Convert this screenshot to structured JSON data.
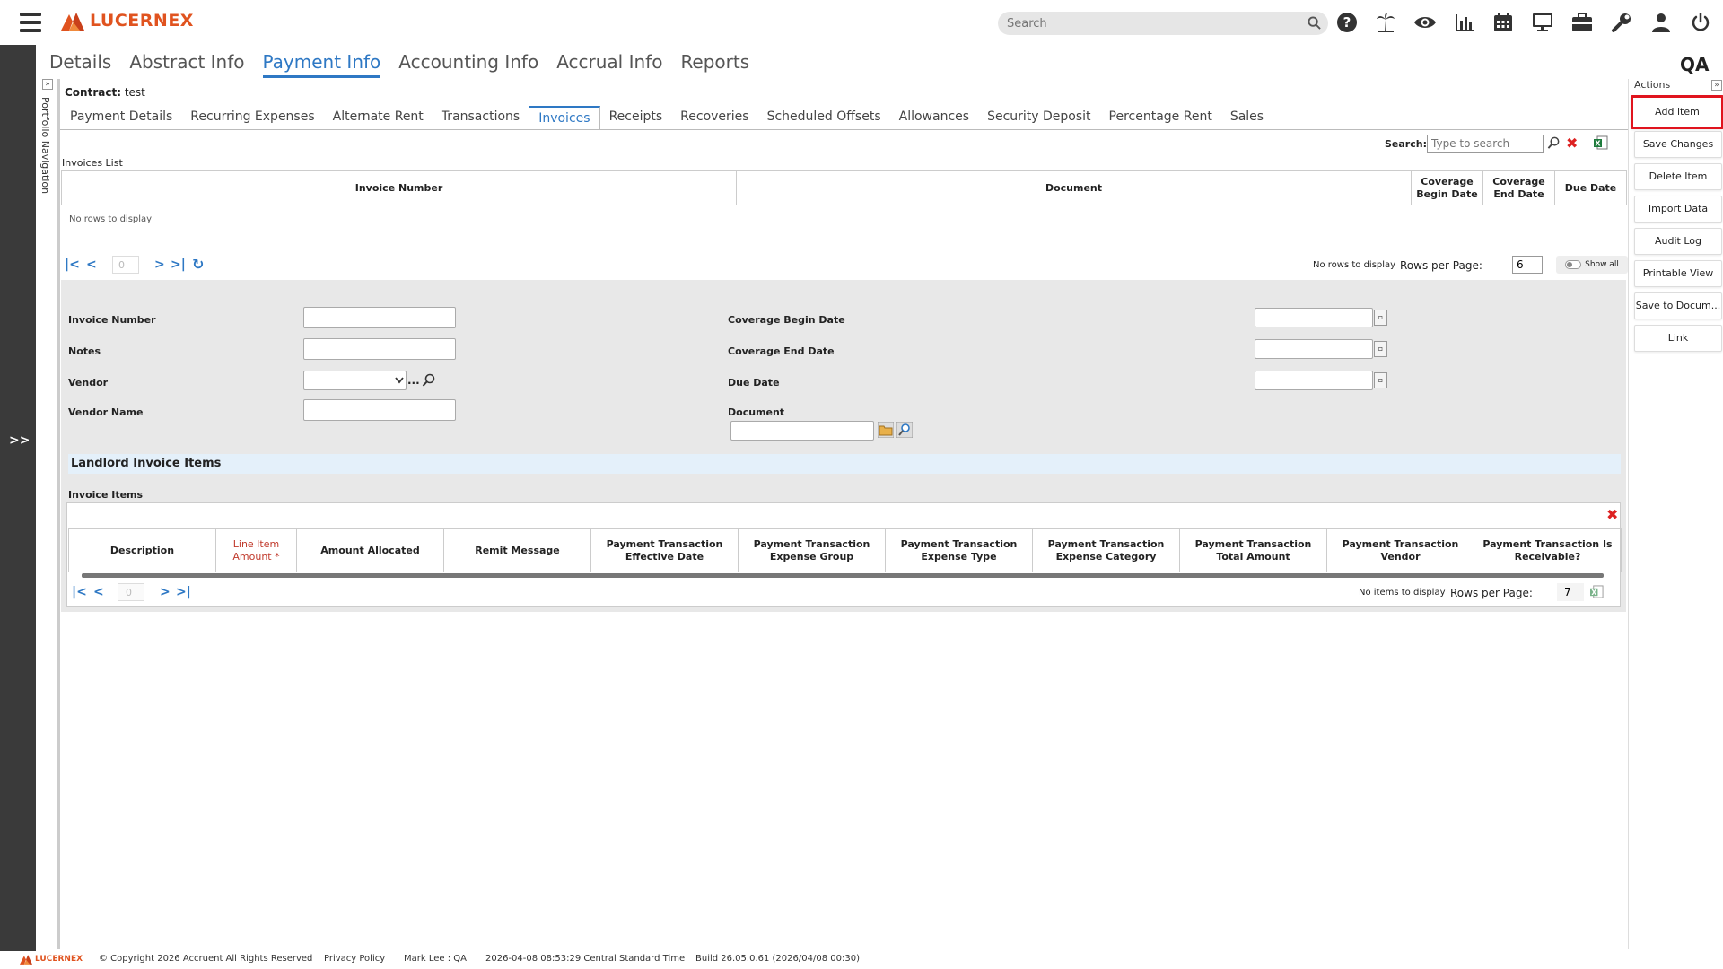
{
  "brand": {
    "name": "LUCERNEX"
  },
  "header": {
    "search_placeholder": "Search",
    "icons": [
      "help-icon",
      "palm-tree-icon",
      "eye-icon",
      "chart-icon",
      "calendar-icon",
      "monitor-icon",
      "briefcase-icon",
      "wrench-icon",
      "user-icon",
      "power-icon"
    ]
  },
  "main_tabs": [
    "Details",
    "Abstract Info",
    "Payment Info",
    "Accounting Info",
    "Accrual Info",
    "Reports"
  ],
  "main_tab_active": "Payment Info",
  "env_label": "QA",
  "left_nav": {
    "expand": ">>",
    "portfolio_label": "Portfolio Navigation",
    "toggle": "»"
  },
  "contract": {
    "label": "Contract:",
    "value": " test"
  },
  "sub_tabs": [
    "Payment Details",
    "Recurring Expenses",
    "Alternate Rent",
    "Transactions",
    "Invoices",
    "Receipts",
    "Recoveries",
    "Scheduled Offsets",
    "Allowances",
    "Security Deposit",
    "Percentage Rent",
    "Sales"
  ],
  "sub_tab_active": "Invoices",
  "invoices_list": {
    "search_label": "Search:",
    "search_placeholder": "Type to search",
    "title": "Invoices List",
    "columns": [
      "Invoice Number",
      "Document",
      "Coverage Begin Date",
      "Coverage End Date",
      "Due Date"
    ],
    "empty_text": "No rows to display",
    "page_value": "0",
    "no_rows": "No rows to display",
    "rows_per_page_label": "Rows per Page:",
    "rows_per_page": "6",
    "show_all": "Show all"
  },
  "form": {
    "invoice_number": "Invoice Number",
    "notes": "Notes",
    "vendor": "Vendor",
    "vendor_name": "Vendor Name",
    "coverage_begin": "Coverage Begin Date",
    "coverage_end": "Coverage End Date",
    "due_date": "Due Date",
    "document": "Document",
    "vendor_ellipsis": "..."
  },
  "landlord": {
    "section_title": "Landlord Invoice Items",
    "items_label": "Invoice Items",
    "columns": [
      "Description",
      "Line Item Amount *",
      "Amount Allocated",
      "Remit Message",
      "Payment Transaction Effective Date",
      "Payment Transaction Expense Group",
      "Payment Transaction Expense Type",
      "Payment Transaction Expense Category",
      "Payment Transaction Total Amount",
      "Payment Transaction Vendor",
      "Payment Transaction Is Receivable?"
    ],
    "page_value": "0",
    "no_items": "No items to display",
    "rows_per_page_label": "Rows per Page:",
    "rows_per_page": "7"
  },
  "actions": {
    "title": "Actions",
    "toggle": "»",
    "buttons": [
      "Add item",
      "Save Changes",
      "Delete Item",
      "Import Data",
      "Audit Log",
      "Printable View",
      "Save to Docum...",
      "Link"
    ],
    "highlighted": "Add item",
    "highlight_color": "#e0141e"
  },
  "footer": {
    "brand": "LUCERNEX",
    "copyright": "© Copyright 2026 Accruent All Rights Reserved",
    "privacy": "Privacy Policy",
    "user": "Mark Lee : QA",
    "timestamp": "2026-04-08 08:53:29 Central Standard Time",
    "build": "Build 26.05.0.61 (2026/04/08 00:30)"
  },
  "colors": {
    "brand": "#e0531f",
    "accent": "#2e78c4",
    "rail": "#3a3a3a",
    "section": "#e4f0fa"
  }
}
